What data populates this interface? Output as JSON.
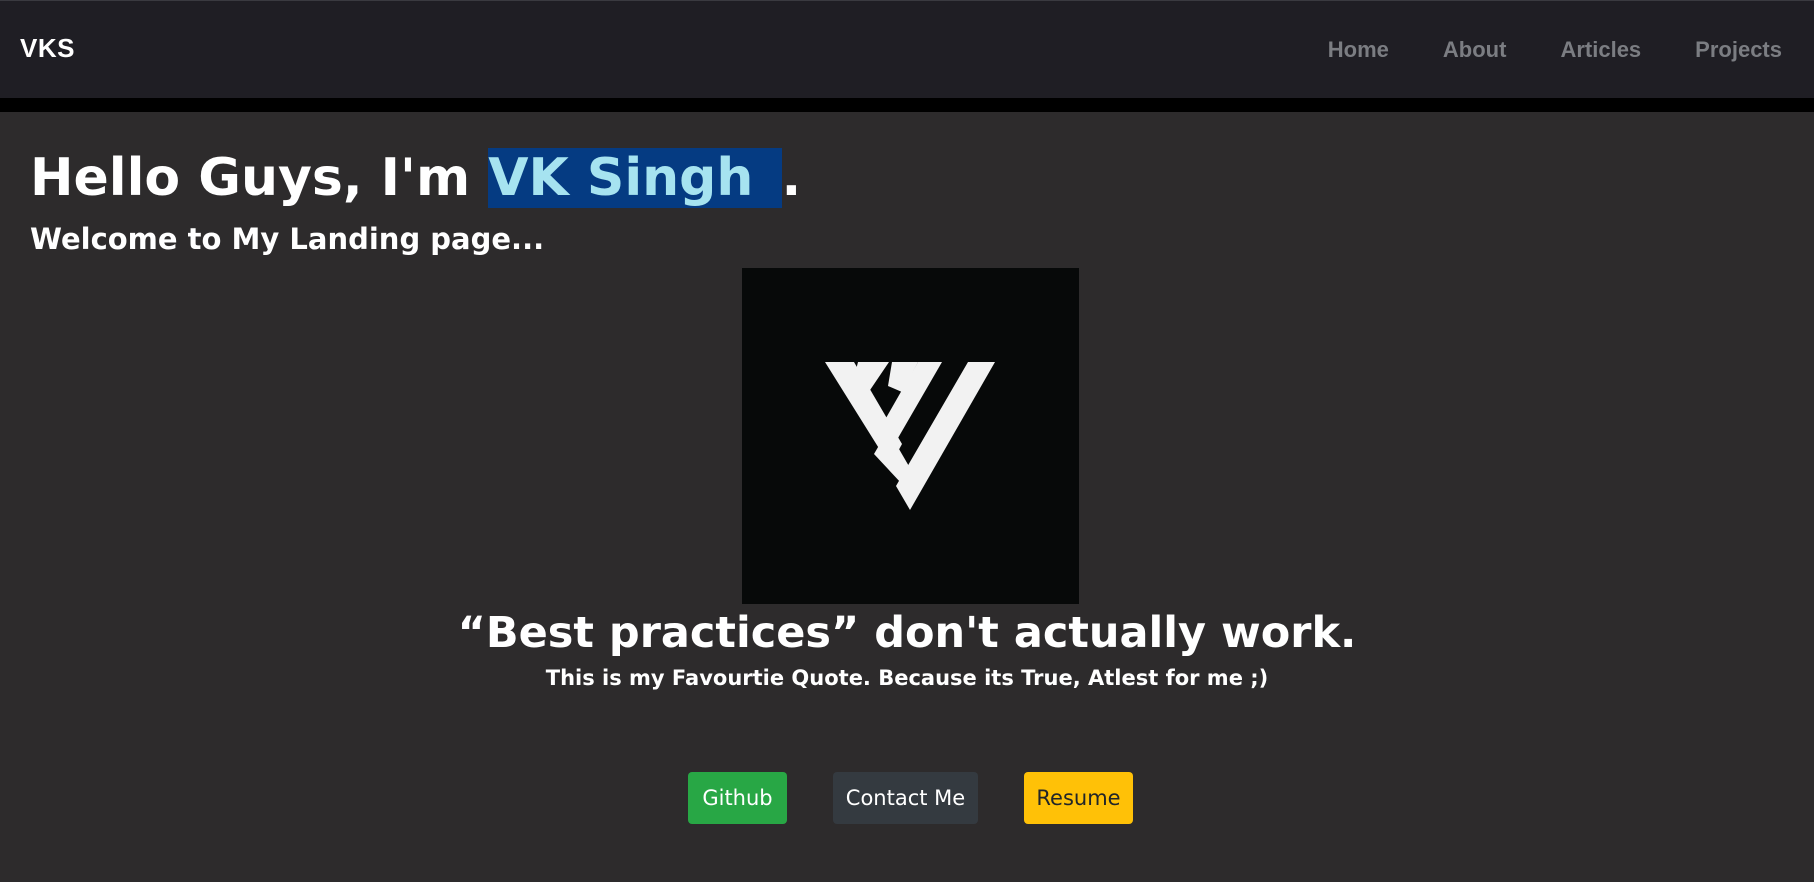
{
  "navbar": {
    "brand": "VKS",
    "links": [
      "Home",
      "About",
      "Articles",
      "Projects"
    ]
  },
  "hero": {
    "greeting_prefix": "Hello Guys, I'm ",
    "name": "VK Singh ",
    "greeting_suffix": ".",
    "subtitle": "Welcome to My Landing page..."
  },
  "logo": {
    "icon": "vks-triangle-logo"
  },
  "quote": {
    "text": "“Best practices” don't actually work.",
    "caption": "This is my Favourtie Quote. Because its True, Atlest for me ;)"
  },
  "buttons": {
    "github": "Github",
    "contact": "Contact Me",
    "resume": "Resume"
  },
  "colors": {
    "background": "#2d2b2c",
    "navbar": "#1f1e24",
    "highlight_bg": "#053b82",
    "highlight_text": "#a6e3f0",
    "github": "#28a745",
    "contact": "#343a40",
    "resume": "#ffc107"
  }
}
